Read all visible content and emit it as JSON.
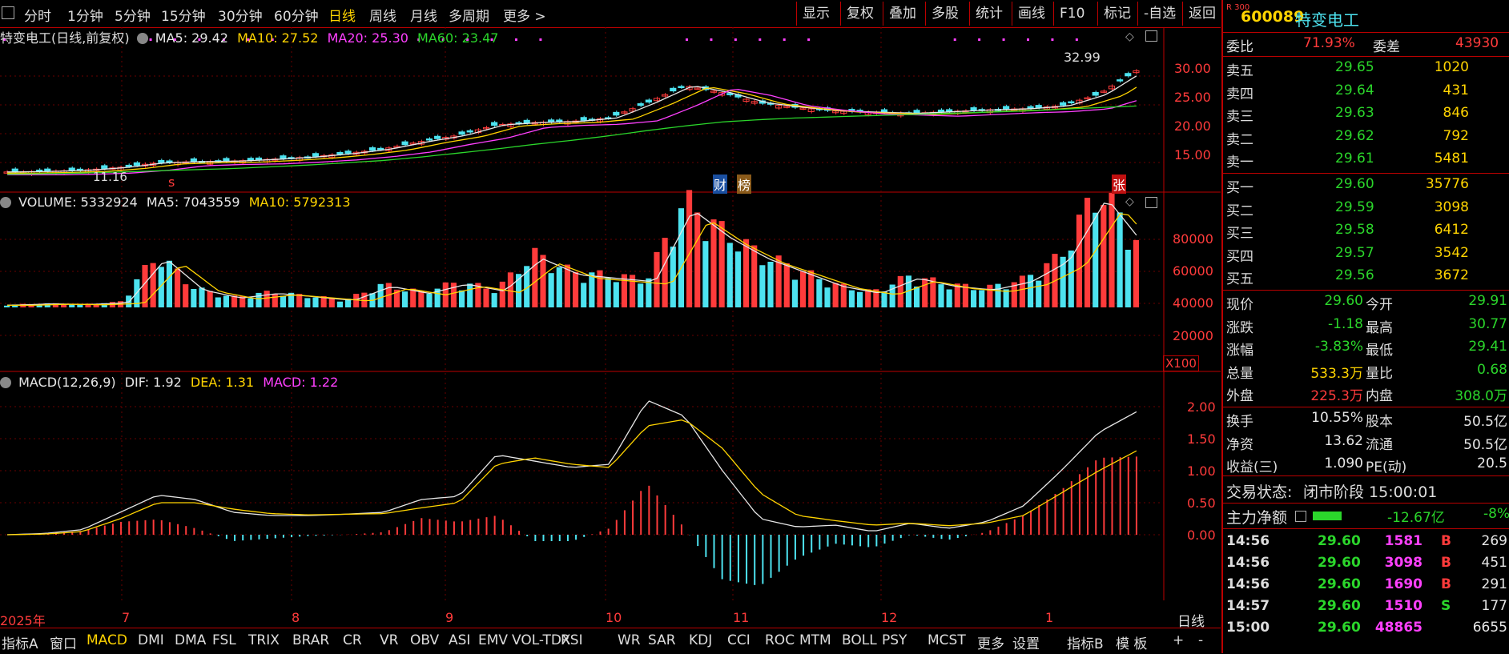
{
  "toolbar": {
    "periods": [
      "分时",
      "1分钟",
      "5分钟",
      "15分钟",
      "30分钟",
      "60分钟",
      "日线",
      "周线",
      "月线",
      "多周期",
      "更多 >"
    ],
    "active_period": "日线",
    "right_buttons": [
      "显示",
      "复权",
      "叠加",
      "多股",
      "统计",
      "画线",
      "F10",
      "标记",
      "-自选",
      "返回"
    ]
  },
  "price_panel": {
    "title": "特变电工(日线,前复权)",
    "ma5": "MA5: 29.42",
    "ma10": "MA10: 27.52",
    "ma20": "MA20: 25.30",
    "ma60": "MA60: 23.47",
    "high_label": "32.99",
    "low_label": "11.16",
    "axis": [
      "30.00",
      "25.00",
      "20.00",
      "15.00"
    ],
    "markers": {
      "s": "s",
      "cai": "财",
      "bang": "榜",
      "zhang": "张"
    }
  },
  "volume_panel": {
    "vol": "VOLUME: 5332924",
    "ma5": "MA5: 7043559",
    "ma10": "MA10: 5792313",
    "axis": [
      "80000",
      "60000",
      "40000",
      "20000"
    ],
    "unit": "X100"
  },
  "macd_panel": {
    "name": "MACD(12,26,9)",
    "dif": "DIF: 1.92",
    "dea": "DEA: 1.31",
    "macd": "MACD: 1.22",
    "axis": [
      "2.00",
      "1.50",
      "1.00",
      "0.50",
      "0.00"
    ]
  },
  "date_axis": {
    "labels": [
      "2025年",
      "7",
      "8",
      "9",
      "10",
      "11",
      "12",
      "1"
    ],
    "period_tag": "日线"
  },
  "bottom_tabs": [
    "指标A",
    "窗口",
    "MACD",
    "DMI",
    "DMA",
    "FSL",
    "TRIX",
    "BRAR",
    "CR",
    "VR",
    "OBV",
    "ASI",
    "EMV",
    "VOL-TDX",
    "RSI",
    "WR",
    "SAR",
    "KDJ",
    "CCI",
    "ROC",
    "MTM",
    "BOLL",
    "PSY",
    "MCST",
    "更多",
    "设置",
    "指标B",
    "模 板",
    "+",
    "-"
  ],
  "active_tab": "MACD",
  "quote": {
    "badge": "R 300",
    "code": "600089",
    "name": "特变电工",
    "weibi_label": "委比",
    "weibi": "71.93%",
    "weicha_label": "委差",
    "weicha": "43930",
    "asks": [
      {
        "label": "卖五",
        "price": "29.65",
        "vol": "1020"
      },
      {
        "label": "卖四",
        "price": "29.64",
        "vol": "431"
      },
      {
        "label": "卖三",
        "price": "29.63",
        "vol": "846"
      },
      {
        "label": "卖二",
        "price": "29.62",
        "vol": "792"
      },
      {
        "label": "卖一",
        "price": "29.61",
        "vol": "5481"
      }
    ],
    "bids": [
      {
        "label": "买一",
        "price": "29.60",
        "vol": "35776"
      },
      {
        "label": "买二",
        "price": "29.59",
        "vol": "3098"
      },
      {
        "label": "买三",
        "price": "29.58",
        "vol": "6412"
      },
      {
        "label": "买四",
        "price": "29.57",
        "vol": "3542"
      },
      {
        "label": "买五",
        "price": "29.56",
        "vol": "3672"
      }
    ],
    "stats": [
      {
        "l1": "现价",
        "v1": "29.60",
        "c1": "green",
        "l2": "今开",
        "v2": "29.91",
        "c2": "green"
      },
      {
        "l1": "涨跌",
        "v1": "-1.18",
        "c1": "green",
        "l2": "最高",
        "v2": "30.77",
        "c2": "green"
      },
      {
        "l1": "涨幅",
        "v1": "-3.83%",
        "c1": "green",
        "l2": "最低",
        "v2": "29.41",
        "c2": "green"
      },
      {
        "l1": "总量",
        "v1": "533.3万",
        "c1": "yellow",
        "l2": "量比",
        "v2": "0.68",
        "c2": "green"
      },
      {
        "l1": "外盘",
        "v1": "225.3万",
        "c1": "red",
        "l2": "内盘",
        "v2": "308.0万",
        "c2": "green"
      }
    ],
    "stats2": [
      {
        "l1": "换手",
        "v1": "10.55%",
        "l2": "股本",
        "v2": "50.5亿"
      },
      {
        "l1": "净资",
        "v1": "13.62",
        "l2": "流通",
        "v2": "50.5亿"
      },
      {
        "l1": "收益(三)",
        "v1": "1.090",
        "l2": "PE(动)",
        "v2": "20.5"
      }
    ],
    "trade_status_label": "交易状态:",
    "trade_status": "闭市阶段 15:00:01",
    "main_flow_label": "主力净额",
    "main_flow": "-12.67亿",
    "main_flow_pct": "-8%",
    "ticks": [
      {
        "time": "14:56",
        "price": "29.60",
        "vol": "1581",
        "side": "B",
        "num": "269"
      },
      {
        "time": "14:56",
        "price": "29.60",
        "vol": "3098",
        "side": "B",
        "num": "451"
      },
      {
        "time": "14:56",
        "price": "29.60",
        "vol": "1690",
        "side": "B",
        "num": "291"
      },
      {
        "time": "14:57",
        "price": "29.60",
        "vol": "1510",
        "side": "S",
        "num": "177"
      },
      {
        "time": "15:00",
        "price": "29.60",
        "vol": "48865",
        "side": "",
        "num": "6655"
      }
    ]
  },
  "chart_data": [
    {
      "type": "line",
      "title": "特变电工(日线,前复权)",
      "ylim": [
        11,
        33
      ],
      "series": [
        {
          "name": "Close",
          "values": [
            12.0,
            12.1,
            12.3,
            12.8,
            13.6,
            13.8,
            13.9,
            14.2,
            14.6,
            15.2,
            16.0,
            17.3,
            18.4,
            20.2,
            20.6,
            20.8,
            21.4,
            24.0,
            27.0,
            25.8,
            24.0,
            23.2,
            22.6,
            22.4,
            22.2,
            22.5,
            22.8,
            23.0,
            23.5,
            25.5,
            29.6
          ]
        },
        {
          "name": "MA60",
          "values": [
            11.6,
            11.7,
            11.8,
            12.0,
            12.2,
            12.4,
            12.6,
            12.9,
            13.2,
            13.6,
            14.0,
            14.6,
            15.3,
            16.0,
            16.8,
            17.5,
            18.3,
            19.2,
            20.0,
            20.7,
            21.1,
            21.4,
            21.6,
            21.8,
            22.0,
            22.2,
            22.4,
            22.6,
            22.9,
            23.2,
            23.47
          ]
        }
      ]
    },
    {
      "type": "bar",
      "title": "VOLUME",
      "ylim": [
        0,
        100000
      ],
      "values": [
        2000,
        3000,
        2500,
        4000,
        42000,
        15000,
        8000,
        12000,
        9000,
        6000,
        18000,
        12000,
        20000,
        14000,
        42000,
        28000,
        25000,
        22000,
        84000,
        60000,
        42000,
        30000,
        18000,
        12000,
        25000,
        18000,
        15000,
        22000,
        40000,
        94000,
        53329
      ]
    },
    {
      "type": "line",
      "title": "MACD(12,26,9)",
      "ylim": [
        -0.3,
        2.3
      ],
      "series": [
        {
          "name": "DIF",
          "values": [
            0.0,
            0.02,
            0.08,
            0.35,
            0.62,
            0.55,
            0.35,
            0.3,
            0.3,
            0.32,
            0.35,
            0.55,
            0.6,
            1.25,
            1.15,
            1.05,
            1.1,
            2.1,
            1.85,
            1.0,
            0.25,
            0.12,
            0.15,
            0.05,
            0.18,
            0.1,
            0.2,
            0.45,
            1.0,
            1.6,
            1.92
          ]
        },
        {
          "name": "DEA",
          "values": [
            0.0,
            0.01,
            0.05,
            0.25,
            0.5,
            0.5,
            0.4,
            0.33,
            0.31,
            0.32,
            0.33,
            0.42,
            0.5,
            1.1,
            1.2,
            1.1,
            1.05,
            1.7,
            1.8,
            1.35,
            0.65,
            0.3,
            0.22,
            0.15,
            0.18,
            0.14,
            0.18,
            0.3,
            0.65,
            1.0,
            1.31
          ]
        }
      ]
    }
  ]
}
